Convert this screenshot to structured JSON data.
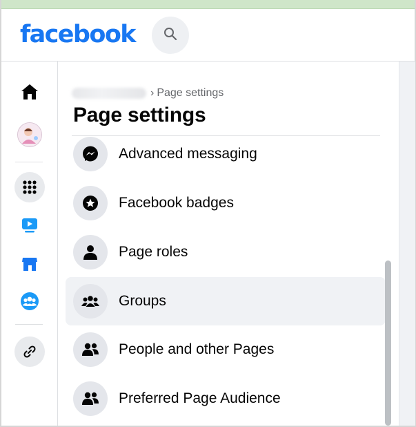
{
  "app": {
    "logo_text": "facebook",
    "brand_color": "#1877f2"
  },
  "topbar": {
    "search_icon": "search-icon"
  },
  "left_rail": {
    "items": [
      {
        "name": "home",
        "icon": "home-icon"
      },
      {
        "name": "profile",
        "icon": "avatar"
      },
      {
        "name": "menu",
        "icon": "grid-dots-icon"
      },
      {
        "name": "watch",
        "icon": "video-play-icon"
      },
      {
        "name": "marketplace",
        "icon": "shop-icon"
      },
      {
        "name": "groups",
        "icon": "groups-icon"
      },
      {
        "name": "link",
        "icon": "link-icon"
      }
    ]
  },
  "main": {
    "breadcrumb": {
      "separator": "›",
      "current": "Page settings"
    },
    "title": "Page settings",
    "items": [
      {
        "label": "Advanced messaging",
        "icon": "messenger-icon",
        "selected": false
      },
      {
        "label": "Facebook badges",
        "icon": "star-badge-icon",
        "selected": false
      },
      {
        "label": "Page roles",
        "icon": "person-icon",
        "selected": false
      },
      {
        "label": "Groups",
        "icon": "groups-icon",
        "selected": true
      },
      {
        "label": "People and other Pages",
        "icon": "people-icon",
        "selected": false
      },
      {
        "label": "Preferred Page Audience",
        "icon": "people-icon",
        "selected": false
      }
    ]
  }
}
